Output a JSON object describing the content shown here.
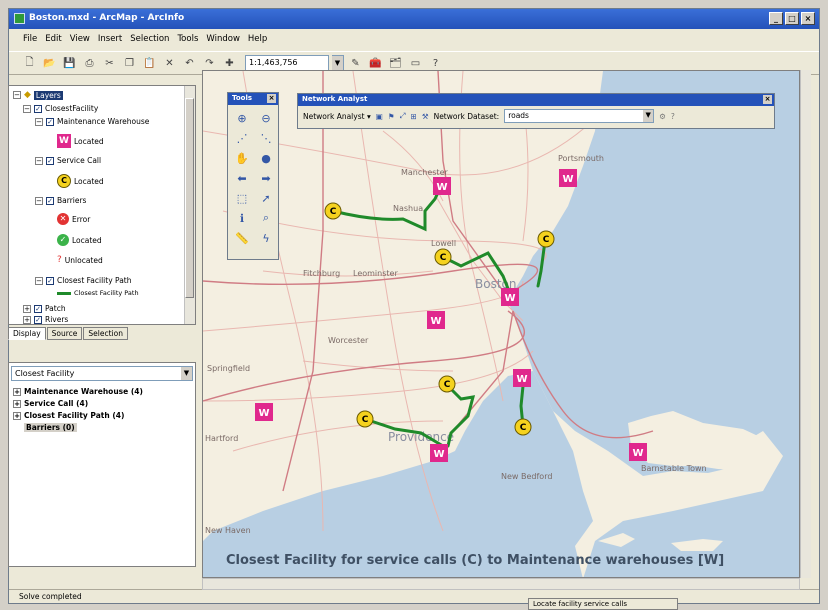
{
  "window": {
    "title": "Boston.mxd - ArcMap - ArcInfo"
  },
  "menu": [
    "File",
    "Edit",
    "View",
    "Insert",
    "Selection",
    "Tools",
    "Window",
    "Help"
  ],
  "toolbar": {
    "scale": "1:1,463,756"
  },
  "toc": {
    "tabs": [
      "Display",
      "Source",
      "Selection"
    ],
    "rows": [
      {
        "label": "Layers",
        "kind": "group"
      },
      {
        "label": "ClosestFacility",
        "kind": "layer"
      },
      {
        "label": "Maintenance Warehouse",
        "kind": "layer"
      },
      {
        "label": "Located",
        "kind": "symbol-w"
      },
      {
        "label": "Service Call",
        "kind": "layer"
      },
      {
        "label": "Located",
        "kind": "symbol-c"
      },
      {
        "label": "Barriers",
        "kind": "layer"
      },
      {
        "label": "Error",
        "kind": "symbol-x"
      },
      {
        "label": "Located",
        "kind": "symbol-ok"
      },
      {
        "label": "Unlocated",
        "kind": "symbol-unloc"
      },
      {
        "label": "Closest Facility Path",
        "kind": "layer"
      },
      {
        "label": "Closest Facility Path",
        "kind": "symbol-line"
      },
      {
        "label": "Patch",
        "kind": "layer"
      },
      {
        "label": "Rivers",
        "kind": "layer"
      }
    ]
  },
  "na_window": {
    "selected": "Closest Facility",
    "items": [
      "Maintenance Warehouse (4)",
      "Service Call (4)",
      "Closest Facility Path (4)",
      "Barriers (0)"
    ]
  },
  "tools_window": {
    "title": "Tools"
  },
  "na_toolbar": {
    "title": "Network Analyst",
    "menu_label": "Network Analyst",
    "dataset_label": "Network Dataset:",
    "dataset_value": "roads"
  },
  "map": {
    "caption": "Closest Facility for service calls (C) to Maintenance warehouses [W]",
    "places": [
      "Portsmouth",
      "Manchester",
      "Nashua",
      "Lowell",
      "Boston",
      "Worcester",
      "Fitchburg",
      "Leominster",
      "Springfield",
      "Hartford",
      "Providence",
      "New Bedford",
      "Barnstable Town",
      "New Haven"
    ],
    "warehouse_symbol": "W",
    "call_symbol": "C",
    "colors": {
      "water": "#b8cfe3",
      "land": "#f4efe1",
      "warehouse": "#e0288d",
      "call": "#f5d21e",
      "route": "#1f8a2a"
    }
  },
  "status": {
    "text": "Solve completed",
    "tip": "Locate facility service calls"
  }
}
